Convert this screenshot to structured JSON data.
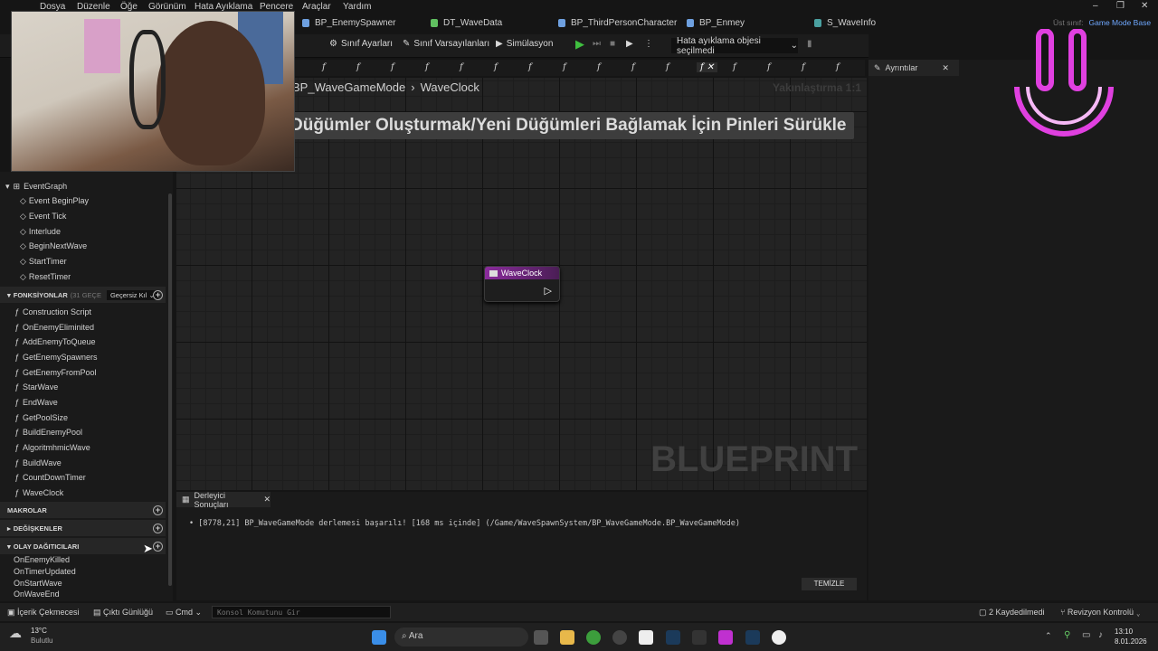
{
  "menubar": {
    "items": [
      "Dosya",
      "Düzenle",
      "Öğe",
      "Görünüm",
      "Hata Ayıklama",
      "Pencere",
      "Araçlar",
      "Yardım"
    ]
  },
  "tabs": [
    {
      "label": "BP_EnemySpawner"
    },
    {
      "label": "DT_WaveData"
    },
    {
      "label": "BP_ThirdPersonCharacter"
    },
    {
      "label": "BP_Enmey"
    },
    {
      "label": "S_WaveInfo"
    }
  ],
  "parent_class": {
    "label": "Üst sınıf:",
    "value": "Game Mode Base"
  },
  "toolbar": {
    "class_settings": "Sınıf Ayarları",
    "class_defaults": "Sınıf Varsayılanları",
    "simulation": "Simülasyon",
    "debug_object": "Hata ayıklama objesi seçilmedi"
  },
  "graph": {
    "breadcrumb_root": "BP_WaveGameMode",
    "breadcrumb_current": "WaveClock",
    "zoom": "Yakınlaştırma 1:1",
    "hint": "Düğümler Oluşturmak/Yeni Düğümleri Bağlamak İçin Pinleri Sürükle",
    "node_title": "WaveClock",
    "watermark": "BLUEPRINT"
  },
  "left": {
    "event_graph": "EventGraph",
    "events": [
      "Event BeginPlay",
      "Event Tick",
      "Interlude",
      "BeginNextWave",
      "StartTimer",
      "ResetTimer"
    ],
    "functions_header": "FONKSİYONLAR",
    "functions_count": "(31 GEÇE",
    "override_label": "Geçersiz Kıl",
    "functions": [
      "Construction Script",
      "OnEnemyEliminited",
      "AddEnemyToQueue",
      "GetEnemySpawners",
      "GetEnemyFromPool",
      "StarWave",
      "EndWave",
      "GetPoolSize",
      "BuildEnemyPool",
      "AlgoritmhmicWave",
      "BuildWave",
      "CountDownTimer",
      "WaveClock"
    ],
    "macros": "MAKROLAR",
    "variables": "DEĞİŞKENLER",
    "dispatchers": "OLAY DAĞITICILARI",
    "dispatcher_items": [
      "OnEnemyKilled",
      "OnTimerUpdated",
      "OnStartWave",
      "OnWaveEnd"
    ]
  },
  "details": {
    "tab": "Ayrıntılar"
  },
  "compiler": {
    "tab": "Derleyici Sonuçları",
    "message": "[8778,21] BP_WaveGameMode derlemesi başarılı! [168 ms içinde] (/Game/WaveSpawnSystem/BP_WaveGameMode.BP_WaveGameMode)",
    "clear": "TEMİZLE"
  },
  "statusbar": {
    "content_drawer": "İçerik Çekmecesi",
    "output_log": "Çıktı Günlüğü",
    "cmd": "Cmd",
    "console_placeholder": "Konsol Komutunu Gir",
    "unsaved": "2 Kaydedilmedi",
    "revision": "Revizyon Kontrolü"
  },
  "taskbar": {
    "weather_temp": "13°C",
    "weather_desc": "Bulutlu",
    "search": "Ara",
    "time": "13:10",
    "date": "8.01.2026"
  },
  "colors": {
    "node_header": "#8a2b9c",
    "accent": "#e040e0",
    "play": "#3fbf3f"
  }
}
